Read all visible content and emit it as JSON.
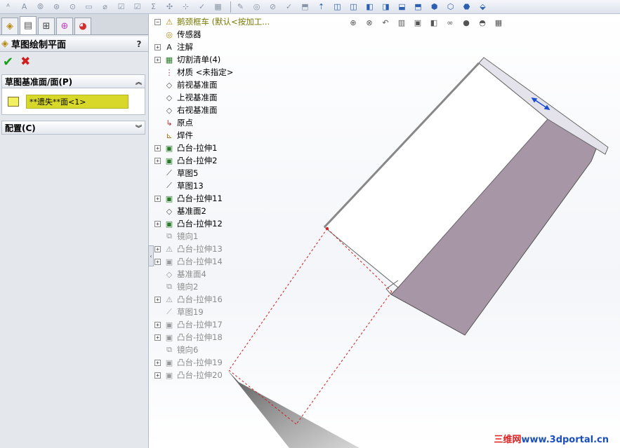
{
  "toolbar": {
    "icons": [
      "spellcheck-icon",
      "note-icon",
      "balloon-icon",
      "auto-balloon-icon",
      "weld-symbol-icon",
      "datum-icon",
      "hole-callout-icon",
      "checkbox-icon",
      "checkbox-icon",
      "sum-icon",
      "center-mark-icon",
      "centerline-icon",
      "smart-dimension-icon",
      "table-icon"
    ],
    "right_icons": [
      "revision-icon",
      "model-items-icon",
      "geometric-tolerance-icon",
      "surface-finish-icon",
      "cylinder-icon",
      "up-arrow-icon",
      "front-view-icon",
      "back-view-icon",
      "left-view-icon",
      "right-view-icon",
      "top-view-icon",
      "bottom-view-icon",
      "isometric-icon",
      "trimetric-icon",
      "dimetric-icon",
      "normal-to-icon"
    ]
  },
  "property_manager": {
    "title": "草图绘制平面",
    "help": "?",
    "sketch_plane_group": {
      "title": "草图基准面/面(P)",
      "selection": "**遗失**面<1>"
    },
    "config_group": {
      "title": "配置(C)"
    }
  },
  "feature_tree": {
    "root": "鹅颈框车  (默认<按加工...",
    "items": [
      {
        "label": "传感器",
        "icon": "sensor-icon",
        "expand": false,
        "dim": false
      },
      {
        "label": "注解",
        "icon": "annotation-icon",
        "expand": true,
        "dim": false
      },
      {
        "label": "切割清单(4)",
        "icon": "cut-list-icon",
        "expand": true,
        "dim": false
      },
      {
        "label": "材质 <未指定>",
        "icon": "material-icon",
        "expand": false,
        "dim": false
      },
      {
        "label": "前视基准面",
        "icon": "plane-icon",
        "expand": false,
        "dim": false
      },
      {
        "label": "上视基准面",
        "icon": "plane-icon",
        "expand": false,
        "dim": false
      },
      {
        "label": "右视基准面",
        "icon": "plane-icon",
        "expand": false,
        "dim": false
      },
      {
        "label": "原点",
        "icon": "origin-icon",
        "expand": false,
        "dim": false
      },
      {
        "label": "焊件",
        "icon": "weldment-icon",
        "expand": false,
        "dim": false
      },
      {
        "label": "凸台-拉伸1",
        "icon": "boss-extrude-icon",
        "expand": true,
        "dim": false
      },
      {
        "label": "凸台-拉伸2",
        "icon": "boss-extrude-icon",
        "expand": true,
        "dim": false
      },
      {
        "label": "草图5",
        "icon": "sketch-icon",
        "expand": false,
        "dim": false
      },
      {
        "label": "草图13",
        "icon": "sketch-icon",
        "expand": false,
        "dim": false
      },
      {
        "label": "凸台-拉伸11",
        "icon": "boss-extrude-icon",
        "expand": true,
        "dim": false
      },
      {
        "label": "基准面2",
        "icon": "plane-icon",
        "expand": false,
        "dim": false
      },
      {
        "label": "凸台-拉伸12",
        "icon": "boss-extrude-icon",
        "expand": true,
        "dim": false
      },
      {
        "label": "镜向1",
        "icon": "mirror-icon",
        "expand": false,
        "dim": true
      },
      {
        "label": "凸台-拉伸13",
        "icon": "warning-icon",
        "expand": true,
        "dim": true
      },
      {
        "label": "凸台-拉伸14",
        "icon": "boss-extrude-icon",
        "expand": true,
        "dim": true
      },
      {
        "label": "基准面4",
        "icon": "plane-icon",
        "expand": false,
        "dim": true
      },
      {
        "label": "镜向2",
        "icon": "mirror-icon",
        "expand": false,
        "dim": true
      },
      {
        "label": "凸台-拉伸16",
        "icon": "warning-icon",
        "expand": true,
        "dim": true
      },
      {
        "label": "草图19",
        "icon": "sketch-icon",
        "expand": false,
        "dim": true
      },
      {
        "label": "凸台-拉伸17",
        "icon": "boss-extrude-icon",
        "expand": true,
        "dim": true
      },
      {
        "label": "凸台-拉伸18",
        "icon": "boss-extrude-icon",
        "expand": true,
        "dim": true
      },
      {
        "label": "镜向6",
        "icon": "mirror-icon",
        "expand": false,
        "dim": true
      },
      {
        "label": "凸台-拉伸19",
        "icon": "boss-extrude-icon",
        "expand": true,
        "dim": true
      },
      {
        "label": "凸台-拉伸20",
        "icon": "boss-extrude-icon",
        "expand": true,
        "dim": true
      }
    ]
  },
  "watermark": {
    "text": "三维网",
    "suffix": "www.3dportal.cn"
  },
  "colors": {
    "accent_selection": "#d8d82a",
    "model_side": "#a696a6",
    "sketch_dash": "#d02020"
  }
}
